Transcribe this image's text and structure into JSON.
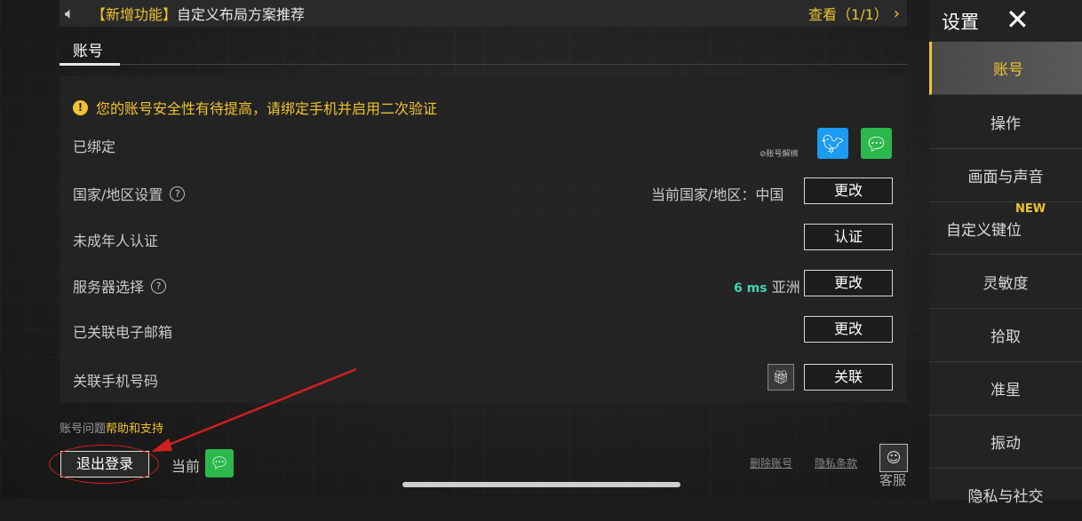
{
  "notice": {
    "tag": "【新增功能】",
    "text": "自定义布局方案推荐",
    "view": "查看（1/1）"
  },
  "section_tab": "账号",
  "panel": {
    "warning": "您的账号安全性有待提高，请绑定手机并启用二次验证",
    "rows": {
      "bound": "已绑定",
      "unbind_link": "账号解绑",
      "region": "国家/地区设置",
      "region_current": "当前国家/地区：中国",
      "region_btn": "更改",
      "minor": "未成年人认证",
      "minor_btn": "认证",
      "server": "服务器选择",
      "ping": "6 ms",
      "server_name": "亚洲",
      "server_btn": "更改",
      "email": "已关联电子邮箱",
      "email_btn": "更改",
      "phone": "关联手机号码",
      "phone_btn": "关联"
    }
  },
  "footer": {
    "help_prefix": "账号问题",
    "help_link": "帮助和支持",
    "logout": "退出登录",
    "current": "当前",
    "delete": "删除账号",
    "privacy": "隐私条款",
    "support": "客服"
  },
  "sidebar": {
    "title": "设置",
    "items": [
      "账号",
      "操作",
      "画面与声音",
      "自定义键位",
      "灵敏度",
      "拾取",
      "准星",
      "振动",
      "隐私与社交"
    ],
    "new_badge": "NEW"
  },
  "colors": {
    "accent": "#f0c330",
    "ping": "#3fd6b0",
    "wechat": "#2db84d",
    "twitter": "#1d9bf0",
    "annotation": "#d02020"
  }
}
